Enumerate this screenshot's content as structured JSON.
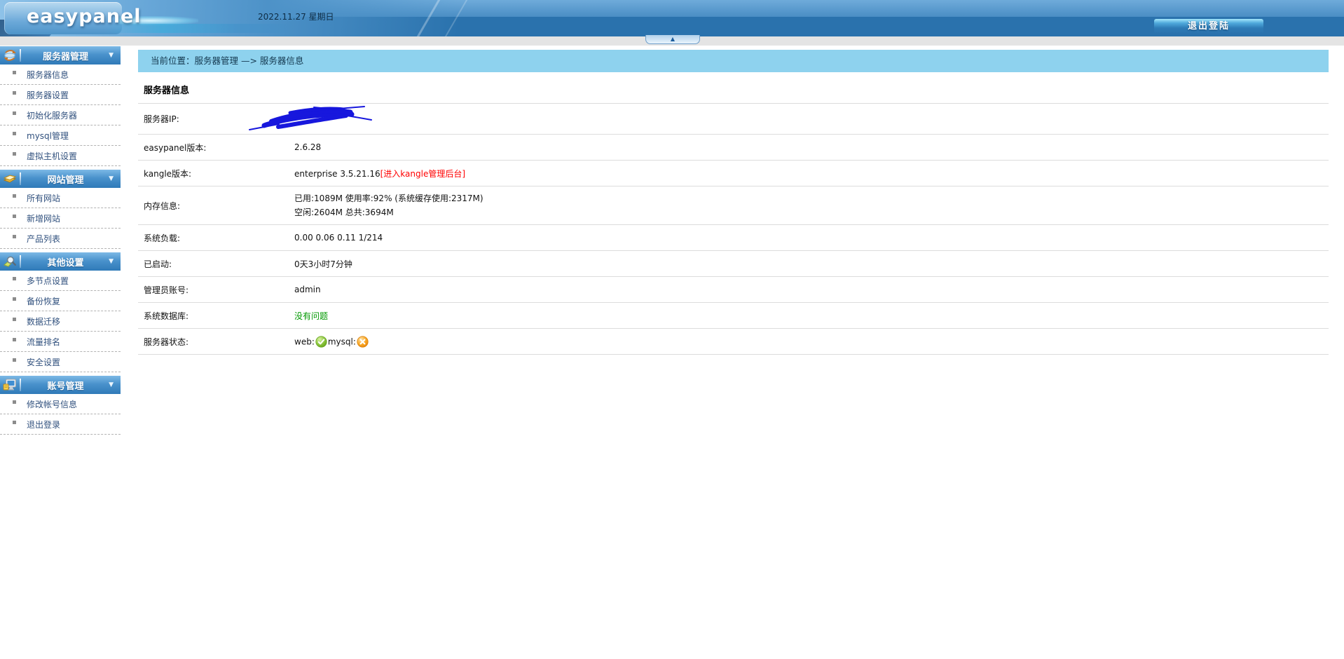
{
  "header": {
    "logo": "easypanel",
    "date": "2022.11.27 星期日",
    "logout_label": "退出登陆",
    "collapse_arrow": "▲"
  },
  "sidebar": {
    "collapse_arrow": "▼",
    "sections": [
      {
        "title": "服务器管理",
        "icon": "globe-sync-icon",
        "items": [
          "服务器信息",
          "服务器设置",
          "初始化服务器",
          "mysql管理",
          "虚拟主机设置"
        ]
      },
      {
        "title": "网站管理",
        "icon": "books-icon",
        "items": [
          "所有网站",
          "新增网站",
          "产品列表"
        ]
      },
      {
        "title": "其他设置",
        "icon": "magnifier-icon",
        "items": [
          "多节点设置",
          "备份恢复",
          "数据迁移",
          "流量排名",
          "安全设置"
        ]
      },
      {
        "title": "账号管理",
        "icon": "monitor-icon",
        "items": [
          "修改帐号信息",
          "退出登录"
        ]
      }
    ]
  },
  "main": {
    "breadcrumb": "当前位置：服务器管理 —> 服务器信息",
    "title": "服务器信息",
    "rows": [
      {
        "label": "服务器IP:",
        "type": "scribble",
        "value": ""
      },
      {
        "label": "easypanel版本:",
        "value": "2.6.28"
      },
      {
        "label": "kangle版本:",
        "type": "kangle",
        "value": "enterprise 3.5.21.16",
        "link": "[进入kangle管理后台]"
      },
      {
        "label": "内存信息:",
        "type": "multiline",
        "lines": [
          "已用:1089M 使用率:92% (系统缓存使用:2317M)",
          "空闲:2604M 总共:3694M"
        ]
      },
      {
        "label": "系统负载:",
        "value": "0.00 0.06 0.11 1/214"
      },
      {
        "label": "已启动:",
        "value": "0天3小时7分钟"
      },
      {
        "label": "管理员账号:",
        "value": "admin"
      },
      {
        "label": "系统数据库:",
        "type": "green",
        "value": "没有问题"
      },
      {
        "label": "服务器状态:",
        "type": "status",
        "items": [
          {
            "name": "web:",
            "state": "ok"
          },
          {
            "name": "mysql:",
            "state": "error"
          }
        ]
      }
    ]
  },
  "colors": {
    "header_band_blue": "#2a72ad",
    "sidebar_header_blue": "#3c85c0",
    "breadcrumb_bg": "#8ed2ee",
    "link_red": "#ff0000",
    "db_ok_green": "#009900",
    "status_ok_green": "#8cc63f",
    "status_error_orange": "#f9a825",
    "scribble_blue": "#1717dd"
  }
}
